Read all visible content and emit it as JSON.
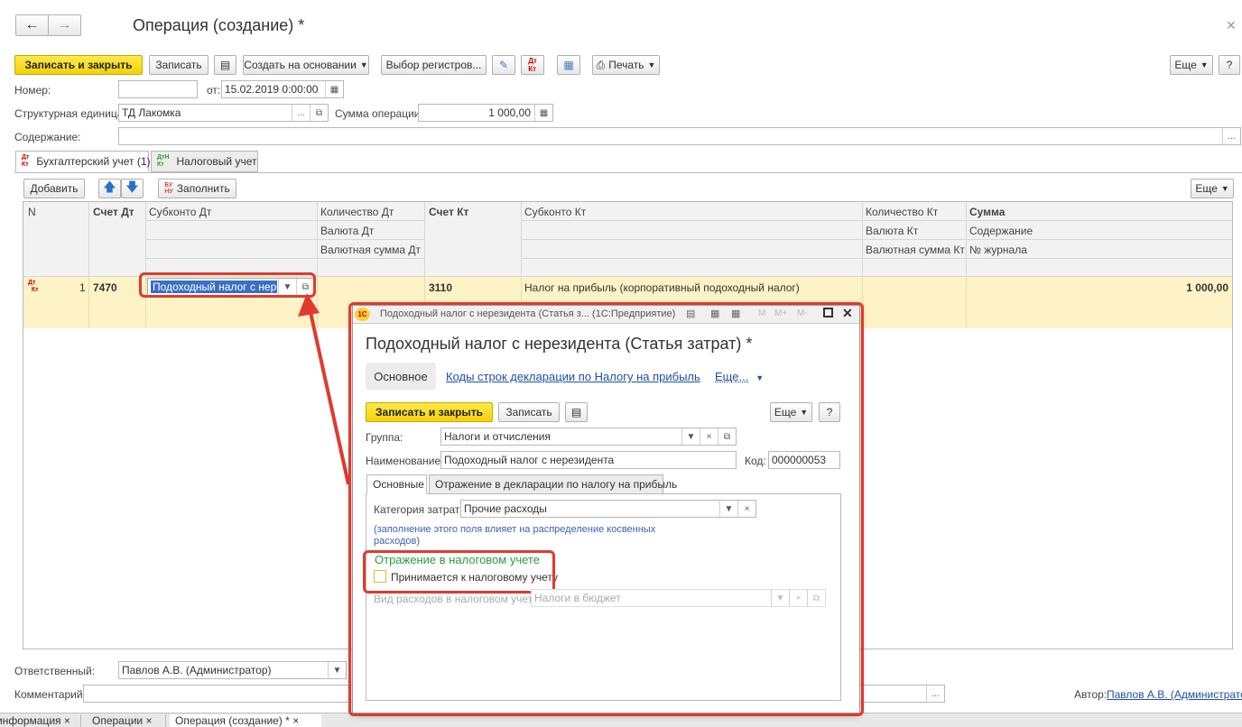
{
  "window": {
    "title": "Операция (создание) *"
  },
  "toolbar": {
    "save_close": "Записать и закрыть",
    "save": "Записать",
    "create_basis": "Создать на основании",
    "registers": "Выбор регистров...",
    "print": "Печать",
    "more": "Еще",
    "help": "?"
  },
  "form": {
    "number_label": "Номер:",
    "number_value": "",
    "from_label": "от:",
    "date_value": "15.02.2019  0:00:00",
    "unit_label": "Структурная единица:",
    "unit_value": "ТД Лакомка",
    "sum_label": "Сумма операции:",
    "sum_value": "1 000,00",
    "content_label": "Содержание:",
    "content_value": ""
  },
  "tabs": [
    "Бухгалтерский учет (1)",
    "Налоговый учет"
  ],
  "table_toolbar": {
    "add": "Добавить",
    "fill": "Заполнить",
    "more": "Еще"
  },
  "columns": {
    "n": "N",
    "acc_dt": "Счет Дт",
    "sub_dt": "Субконто Дт",
    "qty_dt": "Количество Дт",
    "cur_dt": "Валюта Дт",
    "cur_sum_dt": "Валютная сумма Дт",
    "acc_kt": "Счет Кт",
    "sub_kt": "Субконто Кт",
    "qty_kt": "Количество Кт",
    "cur_kt": "Валюта Кт",
    "cur_sum_kt": "Валютная сумма Кт",
    "sum": "Сумма",
    "content": "Содержание",
    "journal": "№ журнала"
  },
  "row": {
    "n": "1",
    "acc_dt": "7470",
    "sub_dt": "Подоходный налог с нерезиде",
    "acc_kt": "3110",
    "sub_kt": "Налог на прибыль (корпоративный подоходный налог)",
    "sum": "1 000,00"
  },
  "footer": {
    "resp_label": "Ответственный:",
    "resp_value": "Павлов А.В. (Администратор)",
    "comment_label": "Комментарий:",
    "comment_value": "",
    "author_label": "Автор:",
    "author_value": "Павлов А.В. (Администратор)"
  },
  "bottom_tabs": [
    "информация",
    "Операции",
    "Операция (создание) *"
  ],
  "dialog": {
    "window_title": "Подоходный налог с нерезидента (Статья з... (1С:Предприятие)",
    "logo": "1С",
    "title": "Подоходный налог с нерезидента (Статья затрат) *",
    "nav": [
      "Основное",
      "Коды строк декларации по Налогу на прибыль",
      "Еще..."
    ],
    "save_close": "Записать и закрыть",
    "save": "Записать",
    "more": "Еще",
    "help": "?",
    "group_label": "Группа:",
    "group_value": "Налоги и отчисления",
    "name_label": "Наименование:",
    "name_value": "Подоходный налог с нерезидента",
    "code_label": "Код:",
    "code_value": "000000053",
    "tabs": [
      "Основные",
      "Отражение в декларации по налогу на прибыль"
    ],
    "cat_label": "Категория затрат:",
    "cat_value": "Прочие расходы",
    "note": "(заполнение этого поля влияет на распределение косвенных расходов)",
    "section": "Отражение в налоговом учете",
    "checkbox_label": "Принимается к налоговому учету",
    "checkbox_checked": false,
    "exp_label": "Вид расходов в налоговом учете:",
    "exp_value": "Налоги в бюджет",
    "mini": [
      "M",
      "M+",
      "M-"
    ]
  },
  "accent": {
    "highlight": "#fdf3c6",
    "red": "#e03a2e",
    "green": "#2e9a3e",
    "link": "#1f4fa8"
  }
}
